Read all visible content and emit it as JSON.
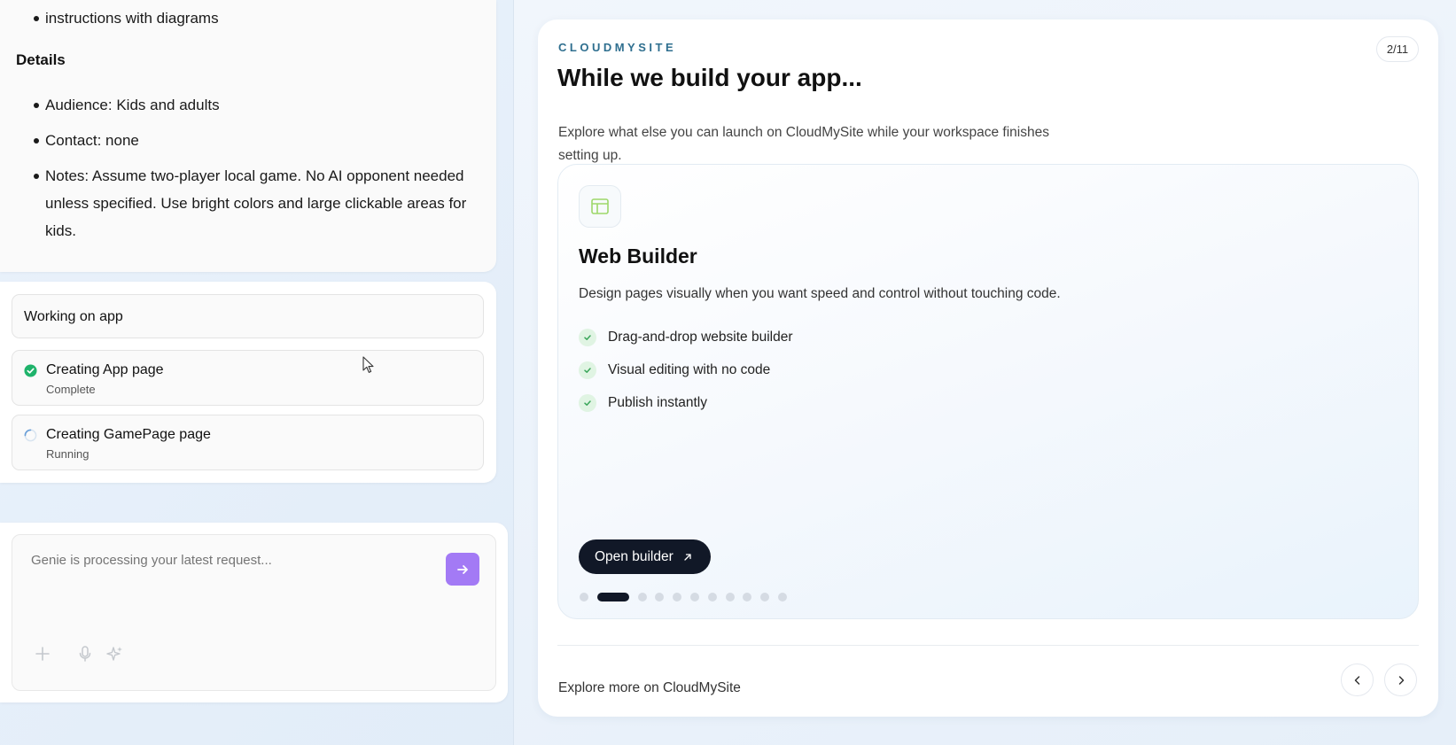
{
  "brief": {
    "top_bullet": "instructions with diagrams",
    "details_heading": "Details",
    "details": [
      "Audience: Kids and adults",
      "Contact: none",
      "Notes: Assume two-player local game. No AI opponent needed unless specified. Use bright colors and large clickable areas for kids."
    ]
  },
  "work": {
    "header": "Working on app",
    "tasks": [
      {
        "title": "Creating App page",
        "status": "Complete",
        "icon": "check-circle-icon"
      },
      {
        "title": "Creating GamePage page",
        "status": "Running",
        "icon": "spinner-icon"
      }
    ]
  },
  "chat_input": {
    "placeholder": "Genie is processing your latest request...",
    "send_icon": "arrow-right-icon",
    "tools": [
      "plus-icon",
      "microphone-icon",
      "sparkle-icon"
    ]
  },
  "promo": {
    "brand": "CLOUDMYSITE",
    "counter": "2/11",
    "title": "While we build your app...",
    "description": "Explore what else you can launch on CloudMySite while your workspace finishes setting up.",
    "feature": {
      "icon": "layout-icon",
      "title": "Web Builder",
      "description": "Design pages visually when you want speed and control without touching code.",
      "items": [
        "Drag-and-drop website builder",
        "Visual editing with no code",
        "Publish instantly"
      ],
      "button_label": "Open builder"
    },
    "dots_total": 11,
    "dots_active_index": 1,
    "footer": "Explore more on CloudMySite"
  },
  "colors": {
    "accent_purple": "#a37af5",
    "brand_teal": "#2f6f8f",
    "success_green": "#1fb36b",
    "dark_button": "#111827"
  }
}
